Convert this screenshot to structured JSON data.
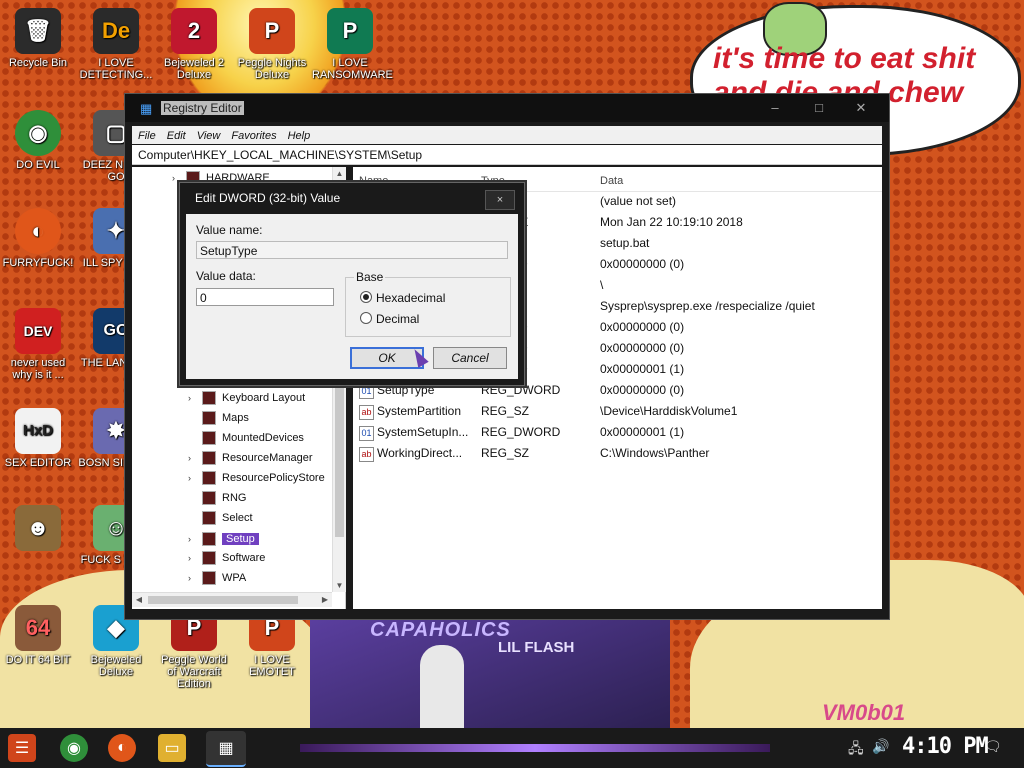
{
  "desktop": {
    "speech_text": "it's time to eat shit and die and chew",
    "poster_title": "CAPAHOLICS",
    "poster_artist": "LIL FLASH",
    "watermark": "VM0b01",
    "icons": [
      {
        "label": "Recycle Bin",
        "glyph": "🗑",
        "color": "#2b2b2b"
      },
      {
        "label": "I LOVE DETECTING...",
        "glyph": "De",
        "color": "#2a2a2a"
      },
      {
        "label": "Bejeweled 2 Deluxe",
        "glyph": "2",
        "color": "#c0182e"
      },
      {
        "label": "Peggle Nights Deluxe",
        "glyph": "P",
        "color": "#d0451b"
      },
      {
        "label": "I LOVE RANSOMWARE",
        "glyph": "P",
        "color": "#107a52"
      },
      {
        "label": "DO EVIL",
        "glyph": "◉",
        "color": "#2f8f3a"
      },
      {
        "label": "DEEZ N HAH GO",
        "glyph": "▢",
        "color": "#555"
      },
      {
        "label": "FURRYFUCK!",
        "glyph": "◐",
        "color": "#e0561a"
      },
      {
        "label": "ILL SPY YOU",
        "glyph": "✦",
        "color": "#4a6fb0"
      },
      {
        "label": "never used why is it ...",
        "glyph": "DEV",
        "color": "#d02020"
      },
      {
        "label": "THE LANGUA",
        "glyph": "GO",
        "color": "#123a6a"
      },
      {
        "label": "SEX EDITOR",
        "glyph": "HxD",
        "color": "#f2f2f2"
      },
      {
        "label": "BOSN SIMULA",
        "glyph": "✸",
        "color": "#6a6ab0"
      },
      {
        "label": "",
        "glyph": "☻",
        "color": "#8a6a3a"
      },
      {
        "label": "FUCK S ELVE",
        "glyph": "☺",
        "color": "#6ab070"
      },
      {
        "label": "DO IT 64 BIT",
        "glyph": "64",
        "color": "#8a5a3a"
      },
      {
        "label": "Bejeweled Deluxe",
        "glyph": "◆",
        "color": "#1aa0d0"
      },
      {
        "label": "Peggle World of Warcraft Edition",
        "glyph": "P",
        "color": "#b0201a"
      },
      {
        "label": "I LOVE EMOTET",
        "glyph": "P",
        "color": "#d0451b"
      }
    ]
  },
  "registry": {
    "title": "Registry Editor",
    "menu": [
      "File",
      "Edit",
      "View",
      "Favorites",
      "Help"
    ],
    "address": "Computer\\HKEY_LOCAL_MACHINE\\SYSTEM\\Setup",
    "tree": [
      {
        "label": "HARDWARE",
        "expander": "›"
      },
      {
        "label": "Keyboard Layout",
        "expander": "›"
      },
      {
        "label": "Maps",
        "expander": ""
      },
      {
        "label": "MountedDevices",
        "expander": ""
      },
      {
        "label": "ResourceManager",
        "expander": "›"
      },
      {
        "label": "ResourcePolicyStore",
        "expander": "›"
      },
      {
        "label": "RNG",
        "expander": ""
      },
      {
        "label": "Select",
        "expander": ""
      },
      {
        "label": "Setup",
        "expander": "›",
        "selected": true
      },
      {
        "label": "Software",
        "expander": "›"
      },
      {
        "label": "WPA",
        "expander": "›"
      }
    ],
    "columns": {
      "name": "Name",
      "type": "Type",
      "data": "Data"
    },
    "rows": [
      {
        "name": "",
        "type": "Z",
        "data": "(value not set)",
        "icon": "ab"
      },
      {
        "name": "",
        "type": "ULTI_SZ",
        "data": "Mon Jan 22 10:19:10 2018",
        "icon": "ab"
      },
      {
        "name": "",
        "type": "Z",
        "data": "setup.bat",
        "icon": "ab"
      },
      {
        "name": "",
        "type": "DWORD",
        "data": "0x00000000 (0)",
        "icon": "01"
      },
      {
        "name": "",
        "type": "Z",
        "data": "\\",
        "icon": "ab"
      },
      {
        "name": "",
        "type": "Z",
        "data": "Sysprep\\sysprep.exe /respecialize /quiet",
        "icon": "ab"
      },
      {
        "name": "",
        "type": "DWORD",
        "data": "0x00000000 (0)",
        "icon": "01"
      },
      {
        "name": "",
        "type": "DWORD",
        "data": "0x00000000 (0)",
        "icon": "01"
      },
      {
        "name": "",
        "type": "DWORD",
        "data": "0x00000001 (1)",
        "icon": "01"
      },
      {
        "name": "SetupType",
        "type": "REG_DWORD",
        "data": "0x00000000 (0)",
        "icon": "01"
      },
      {
        "name": "SystemPartition",
        "type": "REG_SZ",
        "data": "\\Device\\HarddiskVolume1",
        "icon": "ab"
      },
      {
        "name": "SystemSetupIn...",
        "type": "REG_DWORD",
        "data": "0x00000001 (1)",
        "icon": "01"
      },
      {
        "name": "WorkingDirect...",
        "type": "REG_SZ",
        "data": "C:\\Windows\\Panther",
        "icon": "ab"
      }
    ]
  },
  "dialog": {
    "title": "Edit DWORD (32-bit) Value",
    "close": "×",
    "value_name_label": "Value name:",
    "value_name": "SetupType",
    "value_data_label": "Value data:",
    "value_data": "0",
    "base_label": "Base",
    "hex_label": "Hexadecimal",
    "dec_label": "Decimal",
    "hex_selected": true,
    "ok": "OK",
    "cancel": "Cancel"
  },
  "taskbar": {
    "clock": "4:10 PM"
  }
}
